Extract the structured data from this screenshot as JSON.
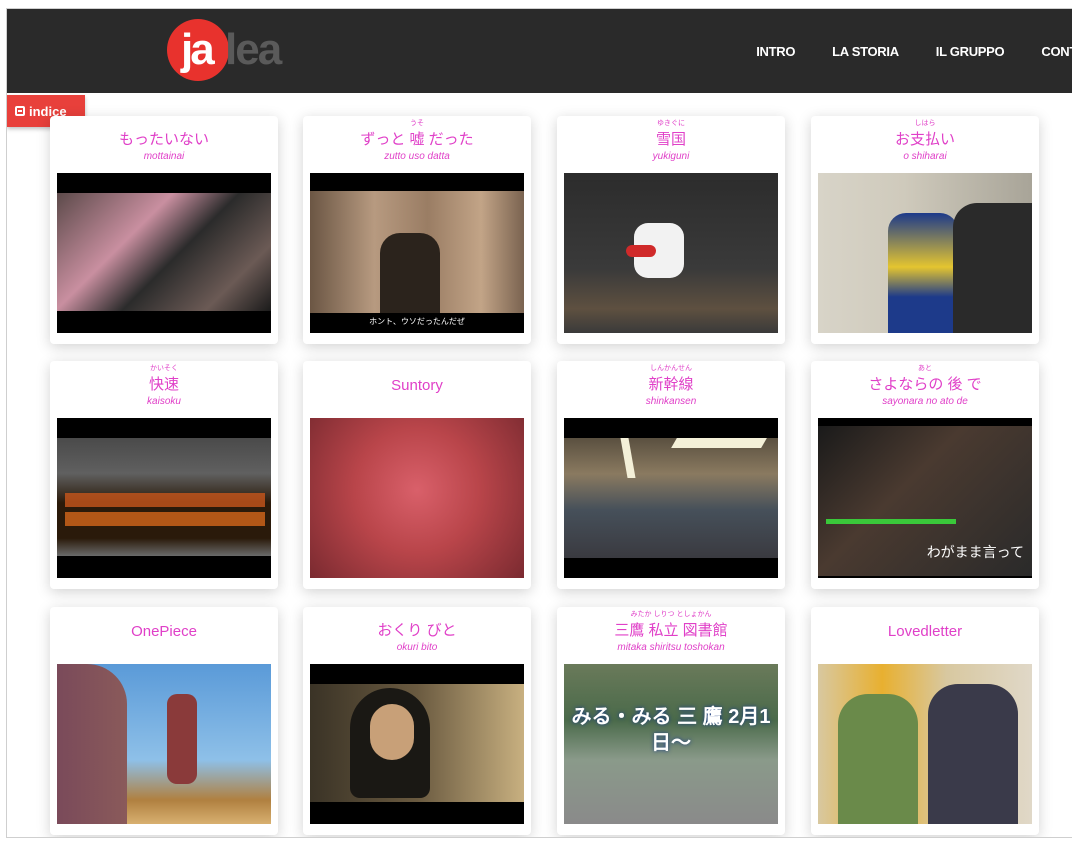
{
  "header": {
    "logo": {
      "primary": "ja",
      "secondary": "lea"
    },
    "menu": [
      "INTRO",
      "LA STORIA",
      "IL GRUPPO",
      "CONT"
    ]
  },
  "indice_label": "indice",
  "cards": [
    {
      "title": "もったいない",
      "ruby": "",
      "romaji": "mottainai",
      "thumb_caption": "",
      "colors": [
        "#1b1b1b",
        "#6b5a55",
        "#c98fa0"
      ]
    },
    {
      "title": "ずっと 嘘 だった",
      "ruby": "うそ",
      "romaji": "zutto   uso   datta",
      "thumb_caption": "ホント、ウソだったんだぜ",
      "colors": [
        "#000000",
        "#9a7d64",
        "#2b231c"
      ]
    },
    {
      "title": "雪国",
      "ruby": "ゆきぐに",
      "romaji": "yukiguni",
      "thumb_caption": "",
      "colors": [
        "#2c2c2c",
        "#3a3a3a",
        "#5e5040"
      ]
    },
    {
      "title": "お支払い",
      "ruby": "しはら",
      "romaji": "o   shiharai",
      "thumb_caption": "",
      "colors": [
        "#d8d4c8",
        "#1d3a8a",
        "#2a2a2a"
      ]
    },
    {
      "title": "快速",
      "ruby": "かいそく",
      "romaji": "kaisoku",
      "thumb_caption": "",
      "colors": [
        "#1d1d1d",
        "#606060",
        "#2a1a0a"
      ]
    },
    {
      "title": "Suntory",
      "ruby": "",
      "romaji": "",
      "thumb_caption": "",
      "colors": [
        "#b9454a",
        "#d9606a",
        "#7a2a30"
      ]
    },
    {
      "title": "新幹線",
      "ruby": "しんかんせん",
      "romaji": "shinkansen",
      "thumb_caption": "",
      "colors": [
        "#000000",
        "#8a7a60",
        "#46505a"
      ]
    },
    {
      "title": "さよならの 後 で",
      "ruby": "あと",
      "romaji": "sayonara   no ato de",
      "thumb_caption": "わがまま言って",
      "colors": [
        "#0e0e0e",
        "#4a3a30",
        "#1a1a1a"
      ]
    },
    {
      "title": "OnePiece",
      "ruby": "",
      "romaji": "",
      "thumb_caption": "",
      "colors": [
        "#5a9ad8",
        "#8a5a5a",
        "#b08040"
      ]
    },
    {
      "title": "おくり びと",
      "ruby": "",
      "romaji": "okuri    bito",
      "thumb_caption": "",
      "colors": [
        "#000000",
        "#3a3326",
        "#c8b080"
      ]
    },
    {
      "title": "三鷹  私立  図書館",
      "ruby": "みたか    しりつ    としょかん",
      "romaji": "mitaka shiritsu toshokan",
      "thumb_caption": "みる・みる 三 鷹 2月1日〜",
      "colors": [
        "#6a7a5a",
        "#4a6a4a",
        "#8a8a8a"
      ]
    },
    {
      "title": "Lovedletter",
      "ruby": "",
      "romaji": "",
      "thumb_caption": "",
      "colors": [
        "#d8c8a0",
        "#3a3a4a",
        "#6a8a4a"
      ]
    }
  ]
}
